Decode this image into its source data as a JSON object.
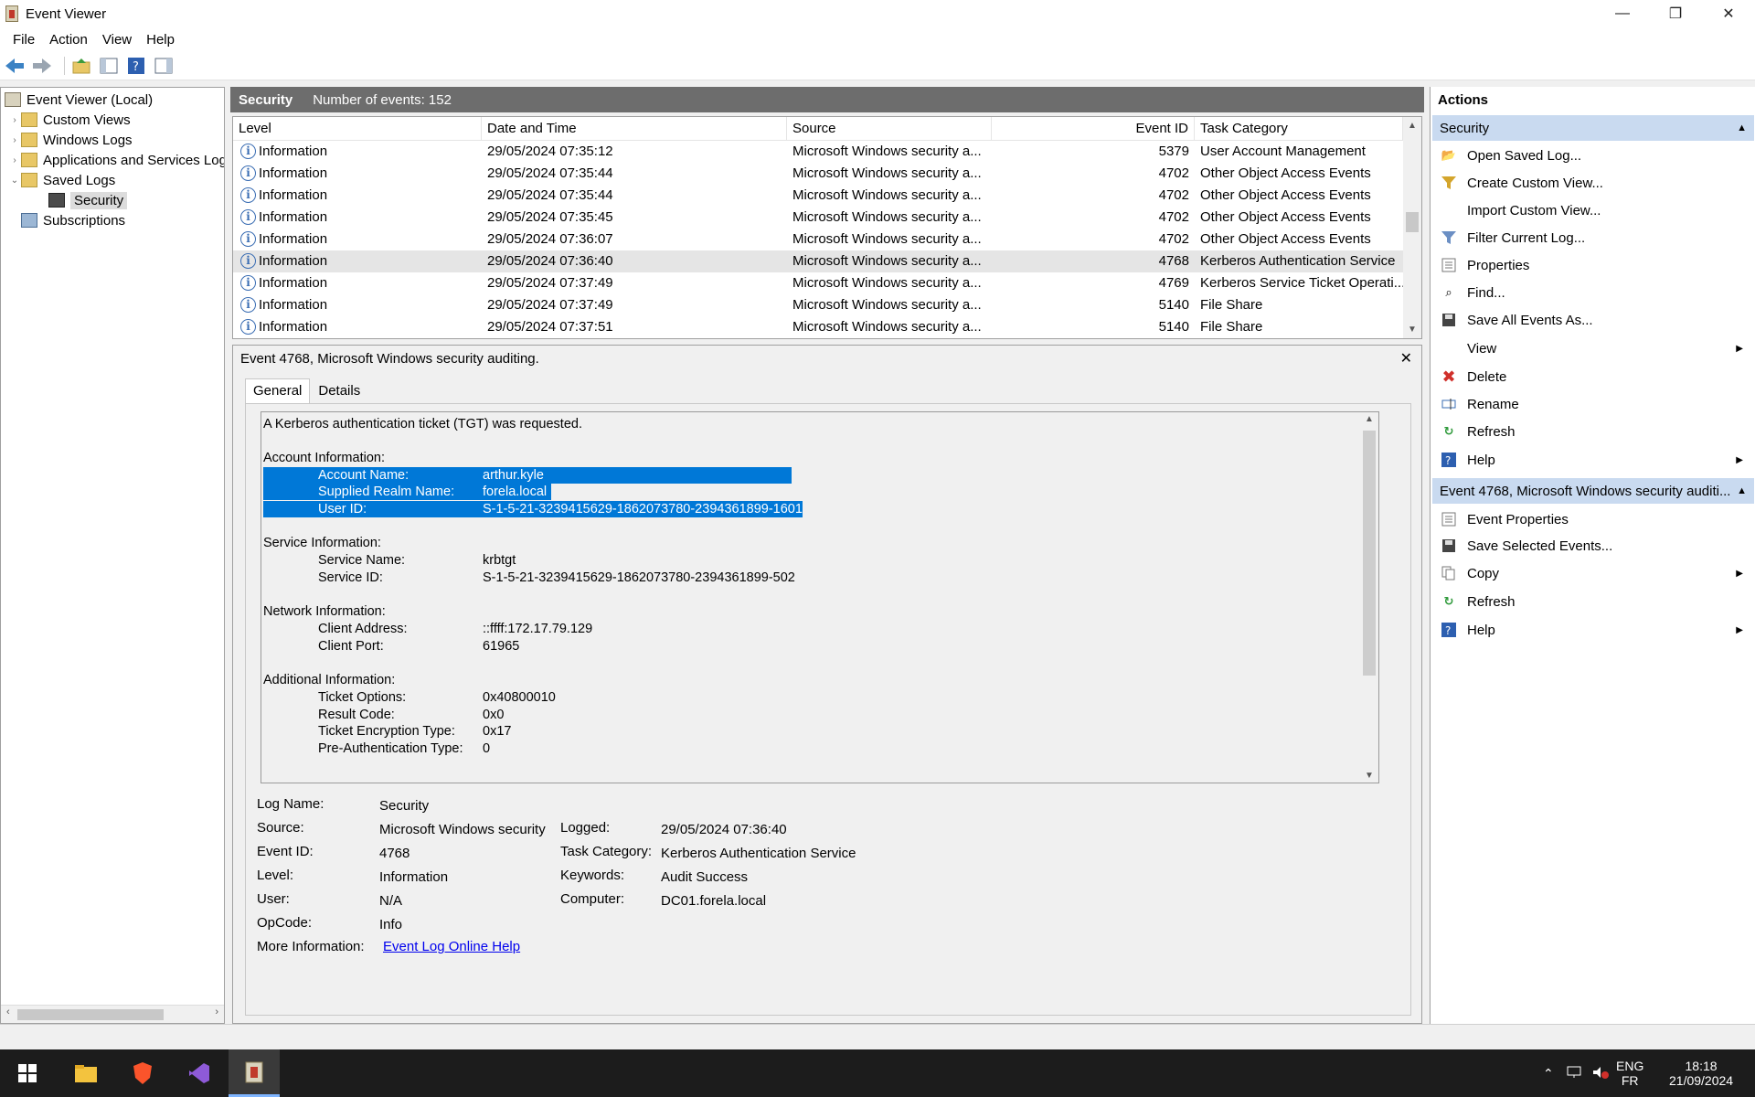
{
  "window": {
    "title": "Event Viewer",
    "minimize": "—",
    "maximize": "❐",
    "close": "✕"
  },
  "menu": [
    "File",
    "Action",
    "View",
    "Help"
  ],
  "tree": {
    "root": "Event Viewer (Local)",
    "items": [
      "Custom Views",
      "Windows Logs",
      "Applications and Services Logs",
      "Saved Logs",
      "Security",
      "Subscriptions"
    ]
  },
  "log": {
    "name": "Security",
    "count": "Number of events: 152"
  },
  "grid": {
    "columns": [
      "Level",
      "Date and Time",
      "Source",
      "Event ID",
      "Task Category"
    ],
    "rows": [
      [
        "Information",
        "29/05/2024 07:35:12",
        "Microsoft Windows security a...",
        "5379",
        "User Account Management"
      ],
      [
        "Information",
        "29/05/2024 07:35:44",
        "Microsoft Windows security a...",
        "4702",
        "Other Object Access Events"
      ],
      [
        "Information",
        "29/05/2024 07:35:44",
        "Microsoft Windows security a...",
        "4702",
        "Other Object Access Events"
      ],
      [
        "Information",
        "29/05/2024 07:35:45",
        "Microsoft Windows security a...",
        "4702",
        "Other Object Access Events"
      ],
      [
        "Information",
        "29/05/2024 07:36:07",
        "Microsoft Windows security a...",
        "4702",
        "Other Object Access Events"
      ],
      [
        "Information",
        "29/05/2024 07:36:40",
        "Microsoft Windows security a...",
        "4768",
        "Kerberos Authentication Service"
      ],
      [
        "Information",
        "29/05/2024 07:37:49",
        "Microsoft Windows security a...",
        "4769",
        "Kerberos Service Ticket Operati..."
      ],
      [
        "Information",
        "29/05/2024 07:37:49",
        "Microsoft Windows security a...",
        "5140",
        "File Share"
      ],
      [
        "Information",
        "29/05/2024 07:37:51",
        "Microsoft Windows security a...",
        "5140",
        "File Share"
      ]
    ]
  },
  "detail": {
    "title": "Event 4768, Microsoft Windows security auditing.",
    "close": "✕",
    "tabs": [
      "General",
      "Details"
    ],
    "description": {
      "intro": "A Kerberos authentication ticket (TGT) was requested.",
      "account_header": "Account Information:",
      "account": [
        [
          "Account Name:",
          "arthur.kyle"
        ],
        [
          "Supplied Realm Name:",
          "forela.local"
        ],
        [
          "User ID:",
          "S-1-5-21-3239415629-1862073780-2394361899-1601"
        ]
      ],
      "service_header": "Service Information:",
      "service": [
        [
          "Service Name:",
          "krbtgt"
        ],
        [
          "Service ID:",
          "S-1-5-21-3239415629-1862073780-2394361899-502"
        ]
      ],
      "network_header": "Network Information:",
      "network": [
        [
          "Client Address:",
          "::ffff:172.17.79.129"
        ],
        [
          "Client Port:",
          "61965"
        ]
      ],
      "additional_header": "Additional Information:",
      "additional": [
        [
          "Ticket Options:",
          "0x40800010"
        ],
        [
          "Result Code:",
          "0x0"
        ],
        [
          "Ticket Encryption Type:",
          "0x17"
        ],
        [
          "Pre-Authentication Type:",
          "0"
        ]
      ]
    },
    "props": {
      "log_name_label": "Log Name:",
      "log_name": "Security",
      "source_label": "Source:",
      "source": "Microsoft Windows security a",
      "logged_label": "Logged:",
      "logged": "29/05/2024 07:36:40",
      "event_id_label": "Event ID:",
      "event_id": "4768",
      "task_category_label": "Task Category:",
      "task_category": "Kerberos Authentication Service",
      "level_label": "Level:",
      "level": "Information",
      "keywords_label": "Keywords:",
      "keywords": "Audit Success",
      "user_label": "User:",
      "user": "N/A",
      "computer_label": "Computer:",
      "computer": "DC01.forela.local",
      "opcode_label": "OpCode:",
      "opcode": "Info",
      "more_info_label": "More Information:",
      "more_info_link": "Event Log Online Help"
    }
  },
  "actions": {
    "title": "Actions",
    "section1": "Security",
    "items1": [
      "Open Saved Log...",
      "Create Custom View...",
      "Import Custom View...",
      "Filter Current Log...",
      "Properties",
      "Find...",
      "Save All Events As...",
      "View",
      "Delete",
      "Rename",
      "Refresh",
      "Help"
    ],
    "section2": "Event 4768, Microsoft Windows security auditi...",
    "items2": [
      "Event Properties",
      "Save Selected Events...",
      "Copy",
      "Refresh",
      "Help"
    ]
  },
  "tray": {
    "lang1": "ENG",
    "lang2": "FR",
    "time": "18:18",
    "date": "21/09/2024"
  },
  "colors": {
    "selection": "#0078d7",
    "section_header": "#c9daf0",
    "log_header": "#6d6d6d"
  }
}
